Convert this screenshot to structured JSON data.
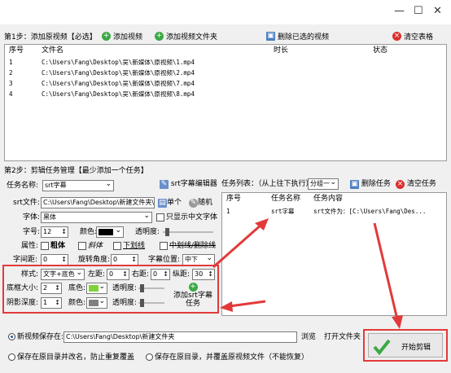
{
  "window": {
    "min": "—",
    "max": "☐",
    "close": "✕"
  },
  "step1": {
    "label": "第1步：添加原视频【必选】",
    "add_video": "添加视频",
    "add_folder": "添加视频文件夹",
    "delete_selected": "删除已选的视频",
    "clear_table": "清空表格"
  },
  "video_table": {
    "headers": [
      "序号",
      "文件名",
      "时长",
      "状态"
    ],
    "rows": [
      {
        "no": "1",
        "file": "C:\\Users\\Fang\\Desktop\\吴\\新媒体\\原视频\\1.mp4"
      },
      {
        "no": "2",
        "file": "C:\\Users\\Fang\\Desktop\\吴\\新媒体\\原视频\\2.mp4"
      },
      {
        "no": "3",
        "file": "C:\\Users\\Fang\\Desktop\\吴\\新媒体\\原视频\\7.mp4"
      },
      {
        "no": "4",
        "file": "C:\\Users\\Fang\\Desktop\\吴\\新媒体\\原视频\\8.mp4"
      }
    ]
  },
  "step2": {
    "label": "第2步：剪辑任务管理【最少添加一个任务】"
  },
  "task_name": {
    "label": "任务名称:",
    "value": "srt字幕"
  },
  "srt_editor": "srt字幕编辑器",
  "srt_file": {
    "label": "srt文件:",
    "value": "C:\\Users\\Fang\\Desktop\\新建文件夹\\",
    "single": "单个",
    "random": "随机"
  },
  "font": {
    "label": "字体:",
    "value": "黑体",
    "only_cn_label": "只显示中文字体"
  },
  "font_size": {
    "label": "字号:",
    "value": "12",
    "color_label": "颜色:",
    "opacity_label": "透明度:"
  },
  "attr": {
    "label": "属性:",
    "bold": "粗体",
    "italic": "斜体",
    "underline": "下划线",
    "strike": "中划线/删除线"
  },
  "spacing": {
    "label": "字间距:",
    "value": "0",
    "rotate_label": "旋转角度:",
    "rotate_value": "0",
    "pos_label": "字幕位置:",
    "pos_value": "中下"
  },
  "style": {
    "label": "样式:",
    "value": "文字+底色",
    "left_label": "左距:",
    "left_value": "0",
    "right_label": "右距:",
    "right_value": "0",
    "top_label": "纵距:",
    "top_value": "30"
  },
  "border": {
    "label": "底框大小:",
    "value": "2",
    "color_label": "底色:",
    "opacity_label": "透明度:"
  },
  "shadow": {
    "label": "阴影深度:",
    "value": "1",
    "color_label": "颜色:",
    "opacity_label": "透明度:"
  },
  "add_srt_task": {
    "line1": "添加srt字幕",
    "line2": "任务"
  },
  "task_list": {
    "label": "任务列表：（从上往下执行）",
    "mode": "分组一",
    "delete": "删除任务",
    "clear": "清空任务",
    "headers": [
      "序号",
      "任务名称",
      "任务内容"
    ],
    "rows": [
      {
        "no": "1",
        "name": "srt字幕",
        "content": "srt文件为：[C:\\Users\\Fang\\Des..."
      }
    ]
  },
  "save": {
    "new_label": "新视频保存在:",
    "path": "C:\\Users\\Fang\\Desktop\\新建文件夹",
    "browse": "浏览",
    "open_folder": "打开文件夹",
    "opt_rename": "保存在原目录并改名，防止重复覆盖",
    "opt_overwrite": "保存在原目录，并覆盖原视频文件（不能恢复）"
  },
  "start_button": "开始剪辑",
  "colors": {
    "accent_red": "#e23a3a",
    "font_color": "#000000",
    "bg_color": "#7fd13b",
    "shadow_color": "#808080"
  }
}
